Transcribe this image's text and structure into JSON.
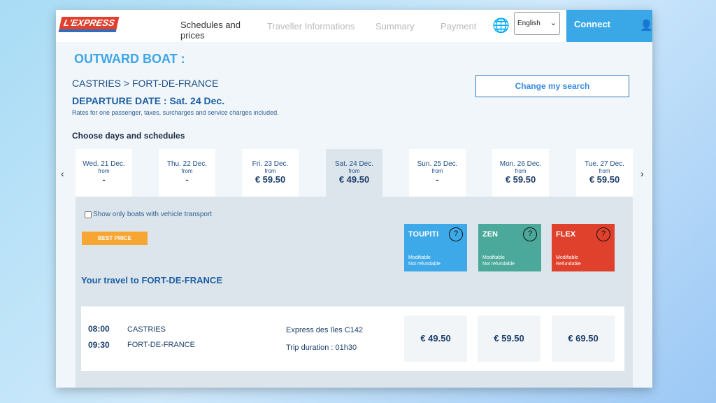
{
  "header": {
    "logo": "L'EXPRESS",
    "steps": [
      "Schedules and prices",
      "Traveller Informations",
      "Summary",
      "Payment"
    ],
    "language": "English",
    "connect": "Connect"
  },
  "title": "OUTWARD BOAT :",
  "route": "CASTRIES > FORT-DE-FRANCE",
  "departure": "DEPARTURE DATE : Sat. 24 Dec.",
  "rates_note": "Rates for one passenger, taxes, surcharges and service charges included.",
  "choose": "Choose days and schedules",
  "change_search": "Change my search",
  "days": [
    {
      "date": "Wed. 21 Dec.",
      "from": "from",
      "price": "-"
    },
    {
      "date": "Thu. 22 Dec.",
      "from": "from",
      "price": "-"
    },
    {
      "date": "Fri. 23 Dec.",
      "from": "from",
      "price": "€ 59.50"
    },
    {
      "date": "Sat. 24 Dec.",
      "from": "from",
      "price": "€ 49.50"
    },
    {
      "date": "Sun. 25 Dec.",
      "from": "from",
      "price": "-"
    },
    {
      "date": "Mon. 26 Dec.",
      "from": "from",
      "price": "€ 59.50"
    },
    {
      "date": "Tue. 27 Dec.",
      "from": "from",
      "price": "€ 59.50"
    }
  ],
  "vehicle_filter": "Show only boats with vehicle transport",
  "best_price": "BEST PRICE",
  "fares": [
    {
      "name": "TOUPITI",
      "l1": "Modifiable",
      "l2": "Not refundable",
      "color": "#3ea9e8"
    },
    {
      "name": "ZEN",
      "l1": "Modifiable",
      "l2": "Not refundable",
      "color": "#4aa99a"
    },
    {
      "name": "FLEX",
      "l1": "Modifiable",
      "l2": "Refundable",
      "color": "#e0412c"
    }
  ],
  "your_travel": "Your travel to FORT-DE-FRANCE",
  "trip": {
    "dep_time": "08:00",
    "dep_place": "CASTRIES",
    "arr_time": "09:30",
    "arr_place": "FORT-DE-FRANCE",
    "vessel": "Express des îles C142",
    "duration": "Trip duration : 01h30",
    "prices": [
      "€ 49.50",
      "€ 59.50",
      "€ 69.50"
    ]
  }
}
